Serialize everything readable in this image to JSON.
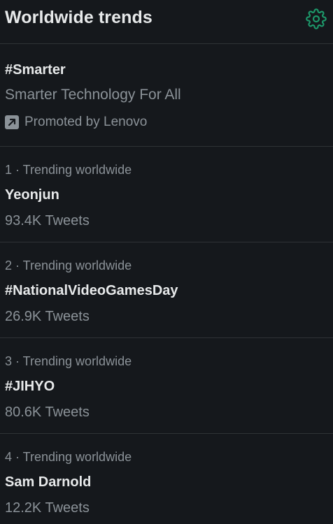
{
  "header": {
    "title": "Worldwide trends",
    "settings_icon": "gear-icon",
    "accent_color": "#1d9b6c"
  },
  "promoted": {
    "name": "#Smarter",
    "description": "Smarter Technology For All",
    "promoted_label": "Promoted by Lenovo",
    "icon": "promoted-icon"
  },
  "trends": [
    {
      "context": "1 · Trending worldwide",
      "name": "Yeonjun",
      "count": "93.4K Tweets"
    },
    {
      "context": "2 · Trending worldwide",
      "name": "#NationalVideoGamesDay",
      "count": "26.9K Tweets"
    },
    {
      "context": "3 · Trending worldwide",
      "name": "#JIHYO",
      "count": "80.6K Tweets"
    },
    {
      "context": "4 · Trending worldwide",
      "name": "Sam Darnold",
      "count": "12.2K Tweets"
    }
  ]
}
